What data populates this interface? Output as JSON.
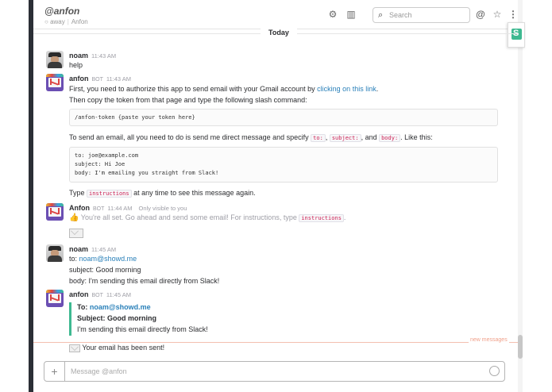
{
  "header": {
    "channel": "@anfon",
    "status": "away",
    "real_name": "Anfon",
    "search_placeholder": "Search"
  },
  "day_divider": "Today",
  "messages": {
    "m1": {
      "author": "noam",
      "time": "11:43 AM",
      "text": "help"
    },
    "m2": {
      "author": "anfon",
      "bot": "BOT",
      "time": "11:43 AM",
      "line1_pre": "First, you need to authorize this app to send email with your Gmail account by ",
      "line1_link": "clicking on this link",
      "line1_post": ".",
      "line2": "Then copy the token from that page and type the following slash command:",
      "code1": "/anfon-token {paste your token here}",
      "line3_pre": "To send an email, all you need to do is send me direct message and specify ",
      "code_to": "to:",
      "comma1": ", ",
      "code_subject": "subject:",
      "and": ", and ",
      "code_body": "body:",
      "line3_post": ". Like this:",
      "code2": "to: joe@example.com\nsubject: Hi Joe\nbody: I'm emailing you straight from Slack!",
      "line4_pre": "Type ",
      "code_instructions": "instructions",
      "line4_post": " at any time to see this message again."
    },
    "m3": {
      "author": "Anfon",
      "bot": "BOT",
      "time": "11:44 AM",
      "only_you": "Only visible to you",
      "text_pre": "You're all set. Go ahead and send some email! For instructions, type ",
      "code": "instructions",
      "text_post": "."
    },
    "m4": {
      "author": "noam",
      "time": "11:45 AM",
      "to_label": "to: ",
      "to_link": "noam@showd.me",
      "subject": "subject: Good morning",
      "body": "body: I'm sending this email directly from Slack!"
    },
    "m5": {
      "author": "anfon",
      "bot": "BOT",
      "time": "11:45 AM",
      "to_label": "To: ",
      "to_link": "noam@showd.me",
      "subject": "Subject: Good morning",
      "body": "I'm sending this email directly from Slack!"
    },
    "m6": {
      "text": "Your email has been sent!"
    }
  },
  "new_messages_label": "new messages",
  "composer": {
    "placeholder": "Message @anfon",
    "plus": "+"
  },
  "colors": {
    "link": "#2a80b9",
    "accent": "#3eb991",
    "new_messages": "#f0a08a"
  },
  "icons": [
    "gear-icon",
    "sidebar-toggle-icon",
    "search-icon",
    "mention-icon",
    "star-icon",
    "more-icon",
    "envelope-icon",
    "thumbs-up-icon",
    "emoji-icon"
  ]
}
